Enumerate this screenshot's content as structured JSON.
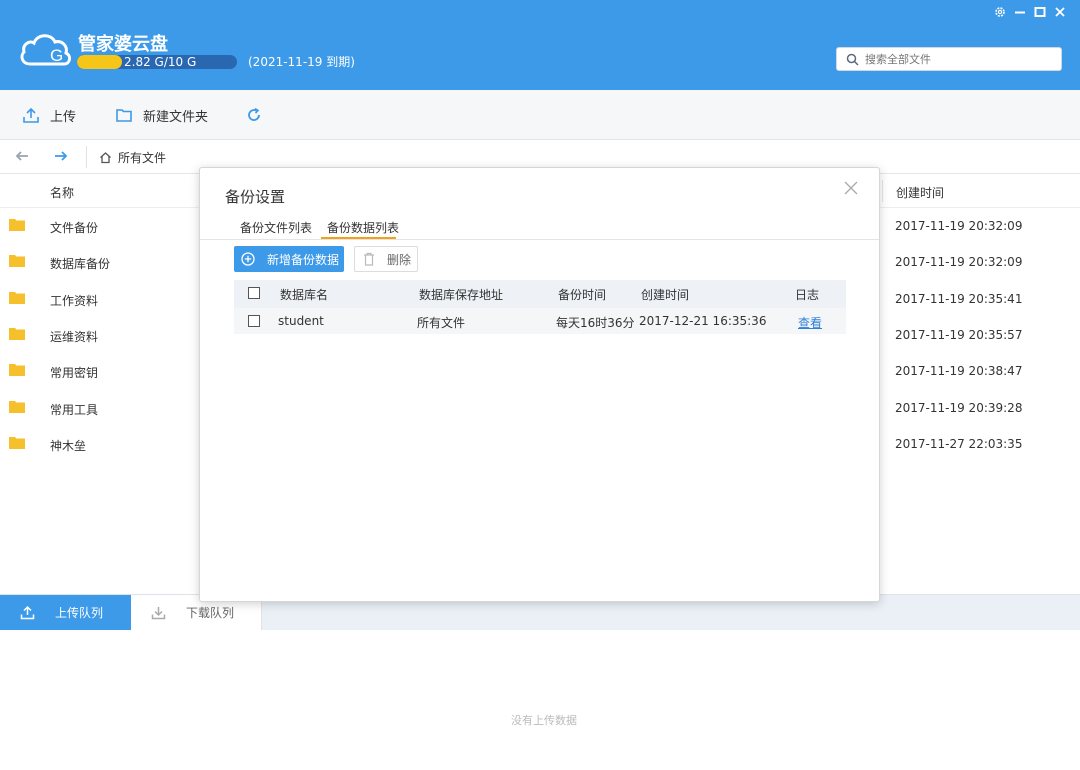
{
  "app": {
    "title": "管家婆云盘",
    "quota_text": "2.82 G/10 G",
    "quota_used_fraction": 0.282,
    "expire_text": "(2021-11-19 到期)",
    "brand_color": "#3d9ae8"
  },
  "window_controls": {
    "settings_icon": "gear-icon",
    "minimize_icon": "minimize-icon",
    "maximize_icon": "maximize-icon",
    "close_icon": "close-icon"
  },
  "search": {
    "placeholder": "搜索全部文件"
  },
  "toolbar": {
    "upload_label": "上传",
    "new_folder_label": "新建文件夹",
    "refresh_icon": "refresh-icon"
  },
  "nav": {
    "path_root": "所有文件"
  },
  "file_list": {
    "headers": {
      "name": "名称",
      "created": "创建时间"
    },
    "rows": [
      {
        "name": "文件备份",
        "created": "2017-11-19 20:32:09"
      },
      {
        "name": "数据库备份",
        "created": "2017-11-19 20:32:09"
      },
      {
        "name": "工作资料",
        "created": "2017-11-19 20:35:41"
      },
      {
        "name": "运维资料",
        "created": "2017-11-19 20:35:57"
      },
      {
        "name": "常用密钥",
        "created": "2017-11-19 20:38:47"
      },
      {
        "name": "常用工具",
        "created": "2017-11-19 20:39:28"
      },
      {
        "name": "神木垒",
        "created": "2017-11-27 22:03:35"
      }
    ]
  },
  "queue": {
    "upload_tab": "上传队列",
    "download_tab": "下载队列",
    "empty_text": "没有上传数据"
  },
  "modal": {
    "title": "备份设置",
    "tabs": [
      "备份文件列表",
      "备份数据列表"
    ],
    "active_tab_color": "#f0a21a",
    "add_button": "新增备份数据",
    "delete_button": "删除",
    "table": {
      "headers": [
        "数据库名",
        "数据库保存地址",
        "备份时间",
        "创建时间",
        "日志"
      ],
      "rows": [
        {
          "db_name": "student",
          "save_path": "所有文件",
          "backup_time": "每天16时36分",
          "created": "2017-12-21 16:35:36",
          "log": "查看"
        }
      ]
    }
  }
}
